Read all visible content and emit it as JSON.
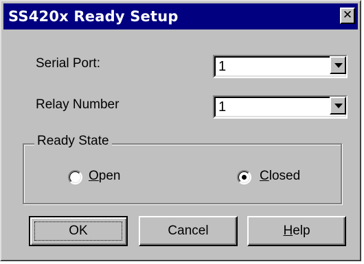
{
  "window": {
    "title": "SS420x Ready Setup",
    "close_glyph": "✕"
  },
  "form": {
    "serial_port": {
      "label": "Serial Port:",
      "value": "1"
    },
    "relay_number": {
      "label": "Relay Number",
      "value": "1"
    }
  },
  "ready_state": {
    "title": "Ready State",
    "options": [
      {
        "mnemonic": "O",
        "rest": "pen",
        "checked": false
      },
      {
        "mnemonic": "C",
        "rest": "losed",
        "checked": true
      }
    ]
  },
  "buttons": {
    "ok": {
      "label": "OK"
    },
    "cancel": {
      "label": "Cancel"
    },
    "help": {
      "mnemonic": "H",
      "rest": "elp"
    }
  },
  "colors": {
    "titlebar": "#000080",
    "face": "#c0c0c0"
  }
}
